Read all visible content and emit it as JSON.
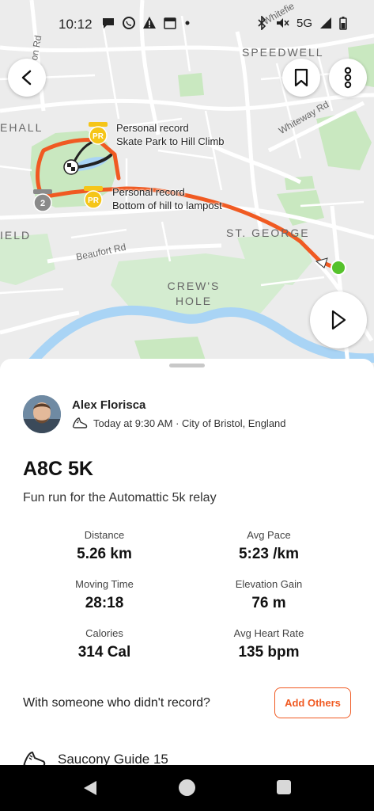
{
  "status_bar": {
    "time": "10:12",
    "network": "5G"
  },
  "map": {
    "area_labels": {
      "speedwell": "SPEEDWELL",
      "st_george": "ST. GEORGE",
      "crews_hole": "CREW'S HOLE",
      "hall_fragment": "EHALL",
      "field_fragment": "IELD"
    },
    "street_labels": {
      "whiteway_rd": "Whiteway Rd",
      "beaufort_rd": "Beaufort Rd",
      "whitefield_fragment": "Whitefie",
      "on_rd_fragment": "on Rd"
    },
    "markers": {
      "pr_badge": "PR",
      "lap_number": "2"
    },
    "segments": [
      {
        "title": "Personal record",
        "name": "Skate Park to Hill Climb"
      },
      {
        "title": "Personal record",
        "name": "Bottom of hill to lampost"
      }
    ],
    "colors": {
      "route": "#f05a22",
      "park": "#c9e8c0",
      "river": "#a9d4f5",
      "start": "#55c22b",
      "pr_gold": "#f5c518"
    }
  },
  "activity": {
    "athlete_name": "Alex Florisca",
    "meta": "Today at 9:30 AM · City of Bristol, England",
    "title": "A8C 5K",
    "description": "Fun run for the Automattic 5k relay",
    "stats": [
      {
        "label": "Distance",
        "value": "5.26 km"
      },
      {
        "label": "Avg Pace",
        "value": "5:23 /km"
      },
      {
        "label": "Moving Time",
        "value": "28:18"
      },
      {
        "label": "Elevation Gain",
        "value": "76 m"
      },
      {
        "label": "Calories",
        "value": "314 Cal"
      },
      {
        "label": "Avg Heart Rate",
        "value": "135 bpm"
      }
    ],
    "with_someone_text": "With someone who didn't record?",
    "add_others_label": "Add Others",
    "gear": "Saucony Guide 15",
    "accent_color": "#f05a22"
  }
}
